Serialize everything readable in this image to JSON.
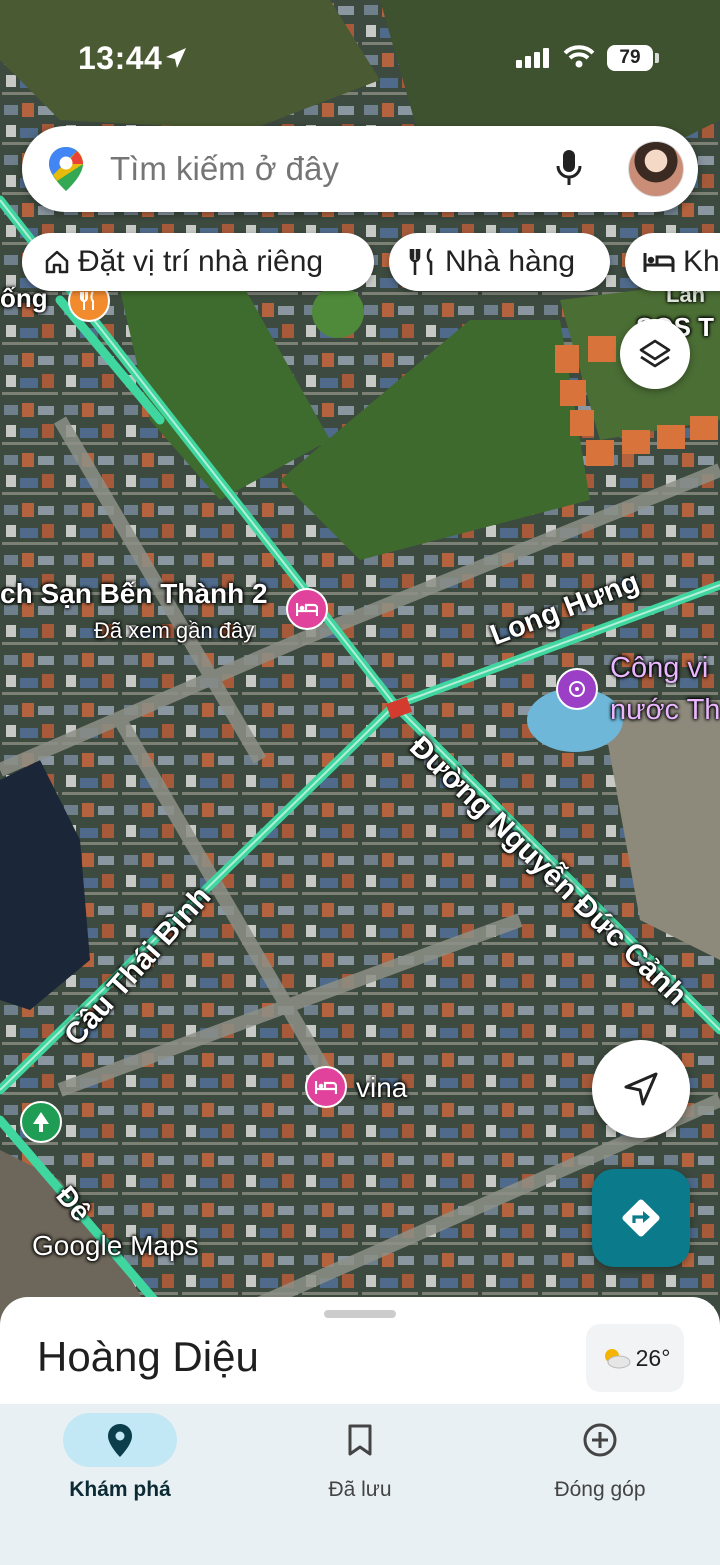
{
  "status": {
    "time": "13:44",
    "battery": "79"
  },
  "search": {
    "placeholder": "Tìm kiếm ở đây"
  },
  "chips": [
    {
      "label": "Đặt vị trí nhà riêng",
      "icon": "home-icon"
    },
    {
      "label": "Nhà hàng",
      "icon": "restaurant-icon"
    },
    {
      "label": "Kh",
      "icon": "hotel-icon"
    }
  ],
  "map": {
    "labels": {
      "hotel_ben_thanh": "ch Sạn Bến Thành 2",
      "viewed_recently": "Đã xem gần đây",
      "long_hung": "Long Hưng",
      "cong_vien_line1": "Công vi",
      "cong_vien_line2": "nước Th",
      "nguyen_duc_canh": "Đường Nguyễn Đức Cảnh",
      "cau_thai_binh": "Cầu Thái Bình",
      "vina": "vina",
      "de": "Đê",
      "ong": "ống",
      "sos": "SOS T",
      "lan": "Lan",
      "watermark": "Google Maps"
    }
  },
  "sheet": {
    "title": "Hoàng Diệu",
    "temperature": "26°"
  },
  "nav": [
    {
      "label": "Khám phá",
      "icon": "explore-pin-icon",
      "active": true
    },
    {
      "label": "Đã lưu",
      "icon": "bookmark-icon",
      "active": false
    },
    {
      "label": "Đóng góp",
      "icon": "add-circle-icon",
      "active": false
    }
  ],
  "colors": {
    "accent": "#0b7a8a",
    "active_nav": "#c2e7f5",
    "hotel_poi": "#e0429c",
    "road": "#3fd6a0"
  }
}
